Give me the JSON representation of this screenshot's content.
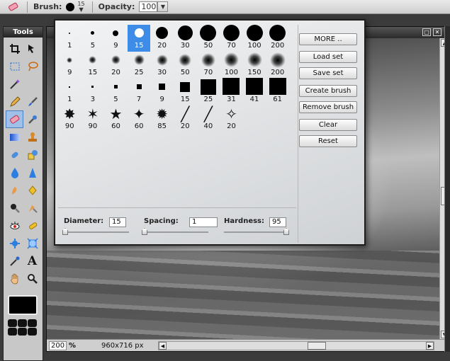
{
  "optionsbar": {
    "brush_label": "Brush:",
    "brush_size": "15",
    "opacity_label": "Opacity:",
    "opacity_value": "100"
  },
  "tools": {
    "title": "Tools",
    "items": [
      "crop-icon",
      "move-icon",
      "marquee-icon",
      "lasso-icon",
      "wand-icon",
      "blank",
      "pencil-icon",
      "brush-icon",
      "eraser-icon",
      "replace-color-icon",
      "gradient-icon",
      "stamp-icon",
      "heal-icon",
      "shape-icon",
      "drop-icon",
      "sharpen-icon",
      "smudge-icon",
      "sponge-icon",
      "burn-icon",
      "dodge-icon",
      "redeye-icon",
      "bloat-icon",
      "pinch-icon",
      "color-picker-icon",
      "text-icon",
      "hand-icon",
      "zoom-icon"
    ]
  },
  "canvas": {
    "zoom": "200",
    "zoom_unit": "%",
    "dimensions": "960x716 px"
  },
  "brushes": {
    "rows": [
      [
        {
          "l": "1",
          "t": "hard",
          "s": 2
        },
        {
          "l": "5",
          "t": "hard",
          "s": 5
        },
        {
          "l": "9",
          "t": "hard",
          "s": 8
        },
        {
          "l": "15",
          "t": "hard",
          "s": 13,
          "sel": true
        },
        {
          "l": "20",
          "t": "hard",
          "s": 17
        },
        {
          "l": "30",
          "t": "hard",
          "s": 21
        },
        {
          "l": "50",
          "t": "hard",
          "s": 23
        },
        {
          "l": "70",
          "t": "hard",
          "s": 23
        },
        {
          "l": "100",
          "t": "hard",
          "s": 23
        },
        {
          "l": "200",
          "t": "hard",
          "s": 23
        }
      ],
      [
        {
          "l": "9",
          "t": "soft",
          "s": 8
        },
        {
          "l": "15",
          "t": "soft",
          "s": 11
        },
        {
          "l": "20",
          "t": "soft",
          "s": 13
        },
        {
          "l": "25",
          "t": "soft",
          "s": 15
        },
        {
          "l": "30",
          "t": "soft",
          "s": 16
        },
        {
          "l": "50",
          "t": "soft",
          "s": 18
        },
        {
          "l": "70",
          "t": "soft",
          "s": 20
        },
        {
          "l": "100",
          "t": "soft",
          "s": 21
        },
        {
          "l": "150",
          "t": "soft",
          "s": 21
        },
        {
          "l": "200",
          "t": "soft",
          "s": 22
        }
      ],
      [
        {
          "l": "1",
          "t": "sq",
          "s": 2
        },
        {
          "l": "3",
          "t": "sq",
          "s": 3
        },
        {
          "l": "5",
          "t": "sq",
          "s": 5
        },
        {
          "l": "7",
          "t": "sq",
          "s": 7
        },
        {
          "l": "9",
          "t": "sq",
          "s": 9
        },
        {
          "l": "15",
          "t": "sq",
          "s": 14
        },
        {
          "l": "25",
          "t": "sq",
          "s": 22
        },
        {
          "l": "31",
          "t": "sq",
          "s": 24
        },
        {
          "l": "41",
          "t": "sq",
          "s": 24
        },
        {
          "l": "61",
          "t": "sq",
          "s": 24
        }
      ],
      [
        {
          "l": "90",
          "t": "splat",
          "g": "✸"
        },
        {
          "l": "90",
          "t": "splat",
          "g": "✶"
        },
        {
          "l": "60",
          "t": "splat",
          "g": "★"
        },
        {
          "l": "60",
          "t": "splat",
          "g": "✦"
        },
        {
          "l": "85",
          "t": "splat",
          "g": "✹"
        },
        {
          "l": "20",
          "t": "splat",
          "g": "╱"
        },
        {
          "l": "40",
          "t": "splat",
          "g": "╱"
        },
        {
          "l": "20",
          "t": "splat",
          "g": "✧"
        }
      ]
    ],
    "buttons": {
      "more": "MORE ..",
      "load": "Load set",
      "save": "Save set",
      "create": "Create brush",
      "remove": "Remove brush",
      "clear": "Clear",
      "reset": "Reset"
    },
    "params": {
      "diameter_label": "Diameter:",
      "diameter_value": "15",
      "spacing_label": "Spacing:",
      "spacing_value": "1",
      "hardness_label": "Hardness:",
      "hardness_value": "95"
    }
  }
}
